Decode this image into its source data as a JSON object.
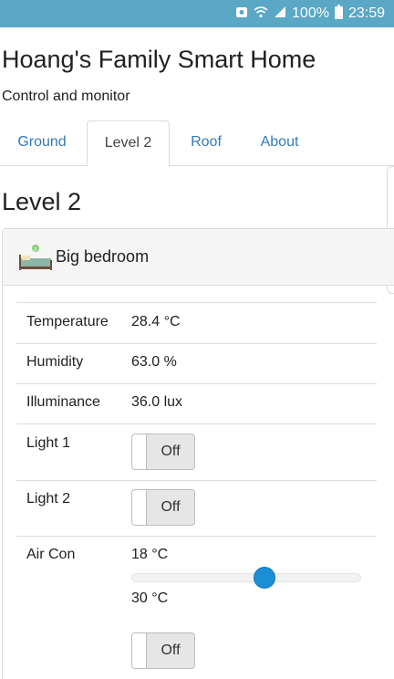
{
  "status_bar": {
    "battery": "100%",
    "time": "23:59",
    "icons": [
      "notification-icon",
      "wifi-icon",
      "signal-icon",
      "battery-icon"
    ]
  },
  "header": {
    "title": "Hoang's Family Smart Home",
    "subtitle": "Control and monitor"
  },
  "tabs": [
    {
      "label": "Ground",
      "active": false
    },
    {
      "label": "Level 2",
      "active": true
    },
    {
      "label": "Roof",
      "active": false
    },
    {
      "label": "About",
      "active": false
    }
  ],
  "page": {
    "heading": "Level 2"
  },
  "room": {
    "name": "Big bedroom",
    "icon": "bedroom-icon",
    "sensors": [
      {
        "label": "Temperature",
        "value": "28.4 °C"
      },
      {
        "label": "Humidity",
        "value": "63.0 %"
      },
      {
        "label": "Illuminance",
        "value": "36.0 lux"
      }
    ],
    "switches": [
      {
        "label": "Light 1",
        "state": "Off"
      },
      {
        "label": "Light 2",
        "state": "Off"
      }
    ],
    "aircon": {
      "label": "Air Con",
      "min_label": "18 °C",
      "max_label": "30 °C",
      "slider_fraction": 0.58,
      "state": "Off"
    }
  },
  "colors": {
    "status_bar": "#5aa7c6",
    "link": "#337ab7",
    "slider_thumb": "#1a8fd6"
  }
}
